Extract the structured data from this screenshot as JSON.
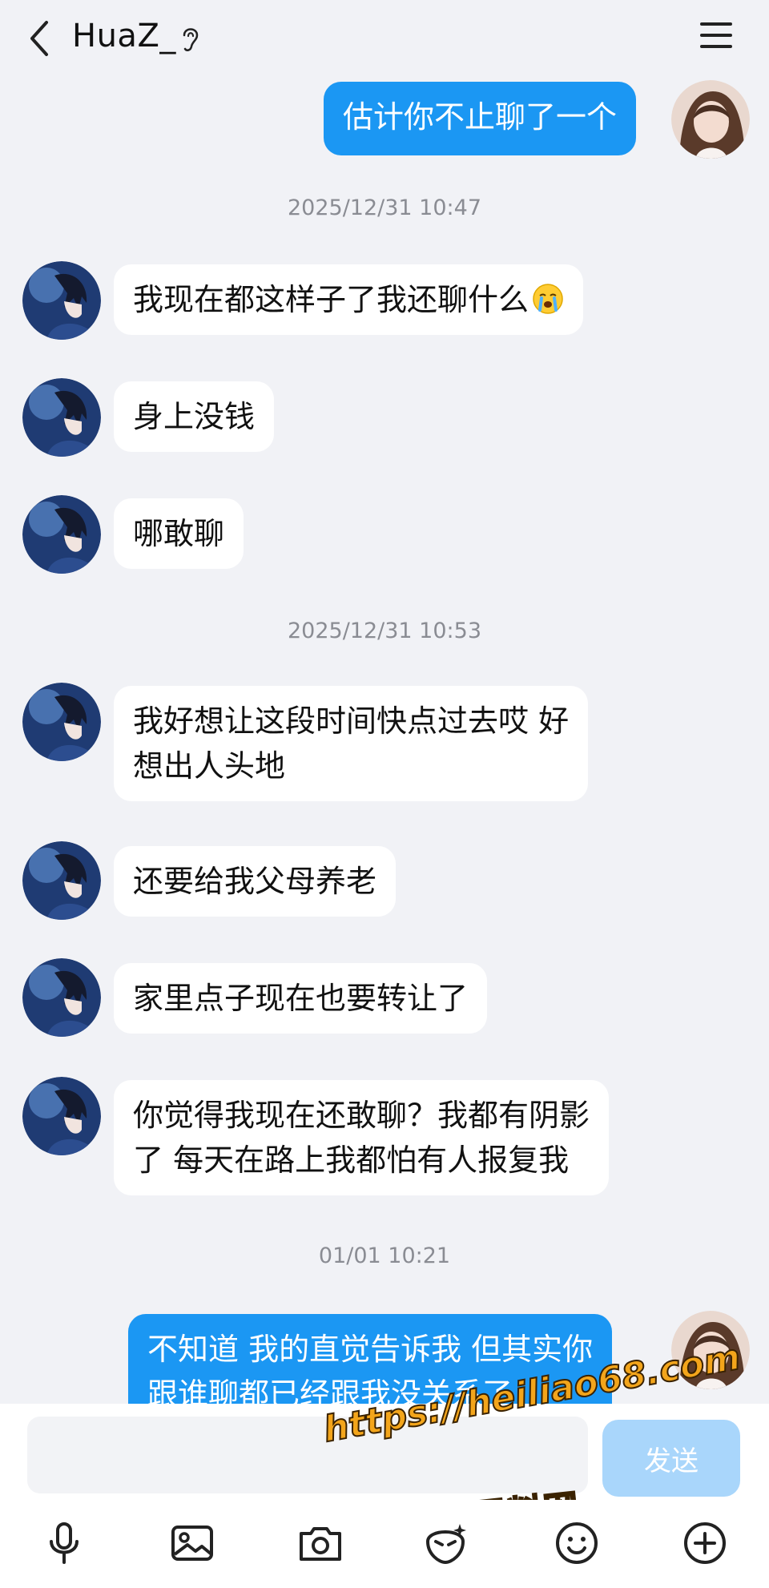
{
  "header": {
    "title": "HuaZ_",
    "back_icon": "chevron-left-icon",
    "ear_icon": "ear-icon",
    "menu_icon": "hamburger-menu-icon"
  },
  "messages": [
    {
      "side": "out",
      "text": "估计你不止聊了一个"
    },
    {
      "type": "timestamp",
      "text": "2025/12/31 10:47"
    },
    {
      "side": "in",
      "text": "我现在都这样子了我还聊什么",
      "emoji": "crying-face-emoji"
    },
    {
      "side": "in",
      "text": "身上没钱"
    },
    {
      "side": "in",
      "text": "哪敢聊"
    },
    {
      "type": "timestamp",
      "text": "2025/12/31 10:53"
    },
    {
      "side": "in",
      "lines": [
        "我好想让这段时间快点过去哎 好",
        "想出人头地"
      ]
    },
    {
      "side": "in",
      "text": "还要给我父母养老"
    },
    {
      "side": "in",
      "text": "家里点子现在也要转让了"
    },
    {
      "side": "in",
      "lines": [
        "你觉得我现在还敢聊？我都有阴影",
        "了 每天在路上我都怕有人报复我"
      ]
    },
    {
      "type": "timestamp",
      "text": "01/01 10:21"
    },
    {
      "side": "out",
      "lines": [
        "不知道 我的直觉告诉我 但其实你",
        "跟谁聊都已经跟我没关系了"
      ]
    }
  ],
  "input": {
    "value": "",
    "send_label": "发送"
  },
  "watermark": {
    "url": "https://heiliao68.com",
    "name": "黑料网"
  },
  "toolbar": [
    "microphone-icon",
    "image-icon",
    "camera-icon",
    "sticker-icon",
    "smiley-icon",
    "plus-circle-icon"
  ],
  "colors": {
    "background": "#f1f2f6",
    "outgoing_bubble": "#1b97f3",
    "incoming_bubble": "#ffffff",
    "send_button": "#a9d6fb"
  }
}
